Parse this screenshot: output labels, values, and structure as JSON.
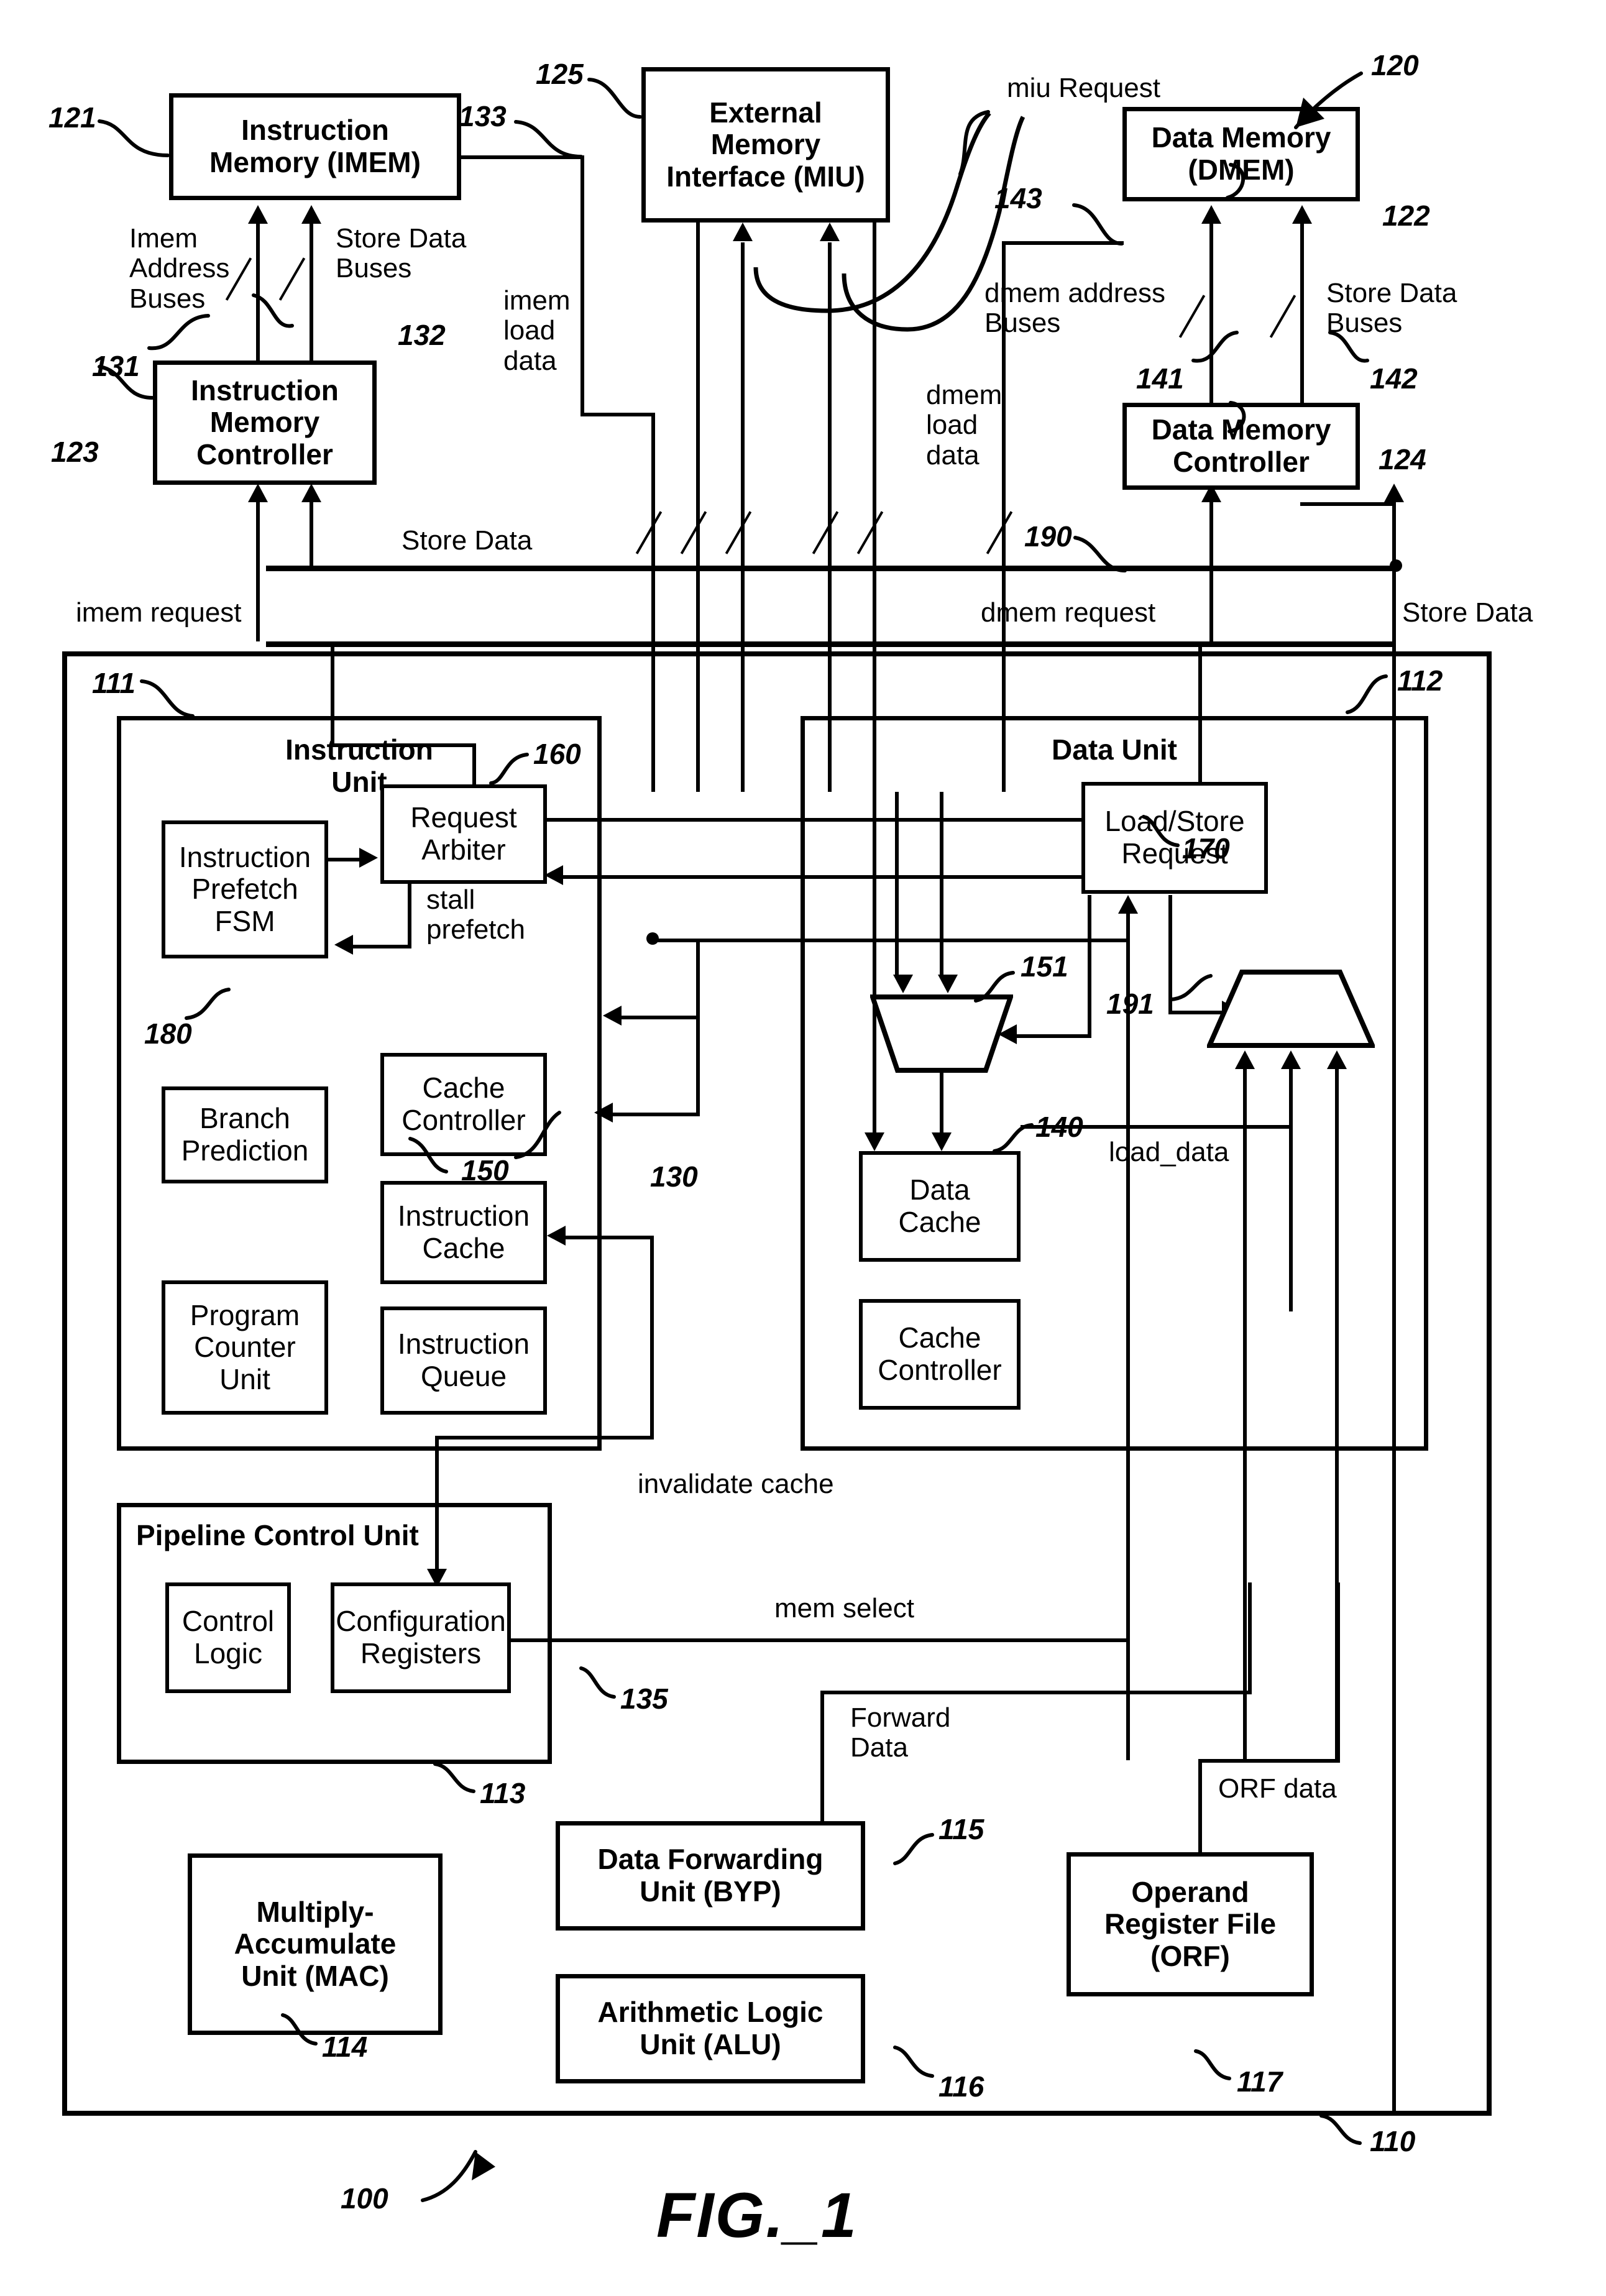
{
  "figure": {
    "caption": "FIG._1",
    "system_ref": "100"
  },
  "blocks": {
    "imem": {
      "label": "Instruction\nMemory (IMEM)",
      "ref": "121"
    },
    "miu": {
      "label": "External\nMemory\nInterface (MIU)",
      "ref": "125"
    },
    "dmem": {
      "label": "Data Memory\n(DMEM)",
      "ref": "122"
    },
    "imem_ctrl": {
      "label": "Instruction\nMemory\nController",
      "ref": "123"
    },
    "dmem_ctrl": {
      "label": "Data Memory\nController",
      "ref": "124"
    },
    "request_arbiter": {
      "label": "Request\nArbiter",
      "ref": "160"
    },
    "prefetch_fsm": {
      "label": "Instruction\nPrefetch\nFSM",
      "ref": "180"
    },
    "icache_ctrl": {
      "label": "Cache\nController",
      "ref": ""
    },
    "branch_pred": {
      "label": "Branch\nPrediction",
      "ref": ""
    },
    "icache": {
      "label": "Instruction\nCache",
      "ref": "130"
    },
    "pc_unit": {
      "label": "Program\nCounter\nUnit",
      "ref": ""
    },
    "iqueue": {
      "label": "Instruction\nQueue",
      "ref": ""
    },
    "load_store_request": {
      "label": "Load/Store\nRequest",
      "ref": "170"
    },
    "dcache": {
      "label": "Data\nCache",
      "ref": "140"
    },
    "dcache_ctrl": {
      "label": "Cache\nController",
      "ref": ""
    },
    "control_logic": {
      "label": "Control\nLogic",
      "ref": ""
    },
    "config_registers": {
      "label": "Configuration\nRegisters",
      "ref": "135"
    },
    "mac": {
      "label": "Multiply-\nAccumulate\nUnit (MAC)",
      "ref": "114"
    },
    "byp": {
      "label": "Data Forwarding\nUnit (BYP)",
      "ref": "115"
    },
    "alu": {
      "label": "Arithmetic Logic\nUnit (ALU)",
      "ref": "116"
    },
    "orf": {
      "label": "Operand\nRegister File\n(ORF)",
      "ref": "117"
    }
  },
  "containers": {
    "memory_subsystem": {
      "ref": "120"
    },
    "core": {
      "ref": "110"
    },
    "instruction_unit": {
      "title": "Instruction\nUnit",
      "ref": "111"
    },
    "data_unit": {
      "title": "Data Unit",
      "ref": "112"
    },
    "pipeline_control_unit": {
      "title": "Pipeline Control Unit",
      "ref": "113"
    }
  },
  "muxes": {
    "dcache_mux": {
      "ref": "151"
    },
    "load_mux": {
      "ref": "191"
    }
  },
  "signals": {
    "imem_address_buses": {
      "label": "Imem\nAddress\nBuses",
      "ref": "131"
    },
    "imem_store_data_buses": {
      "label": "Store Data\nBuses",
      "ref": "132"
    },
    "imem_load_data": {
      "label": "imem\nload\ndata",
      "ref": "133"
    },
    "miu_request": {
      "label": "miu Request",
      "ref": ""
    },
    "dmem_address_buses": {
      "label": "dmem address\nBuses",
      "ref": "141"
    },
    "dmem_store_data_buses": {
      "label": "Store Data\nBuses",
      "ref": "142"
    },
    "dmem_load_data": {
      "label": "dmem\nload\ndata",
      "ref": "143"
    },
    "store_data_upper": {
      "label": "Store Data",
      "ref": ""
    },
    "store_data_bus": {
      "label": "Store Data",
      "ref": "190"
    },
    "store_data_right": {
      "label": "Store Data",
      "ref": ""
    },
    "imem_request": {
      "label": "imem request",
      "ref": ""
    },
    "dmem_request": {
      "label": "dmem request",
      "ref": ""
    },
    "stall_prefetch": {
      "label": "stall\nprefetch",
      "ref": ""
    },
    "arbiter_bus": {
      "ref": "150"
    },
    "invalidate_cache": {
      "label": "invalidate cache",
      "ref": ""
    },
    "mem_select": {
      "label": "mem select",
      "ref": ""
    },
    "load_data": {
      "label": "load_data",
      "ref": ""
    },
    "forward_data": {
      "label": "Forward\nData",
      "ref": ""
    },
    "orf_data": {
      "label": "ORF data",
      "ref": ""
    }
  }
}
